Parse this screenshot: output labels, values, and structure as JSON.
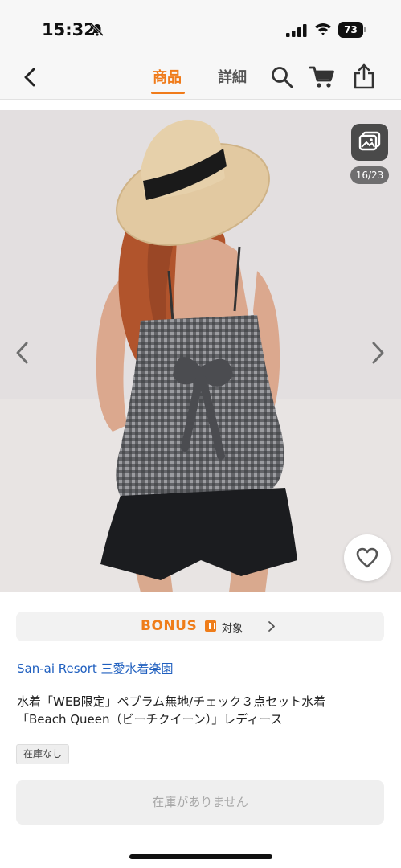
{
  "status_bar": {
    "time": "15:32",
    "battery": "73"
  },
  "nav": {
    "tab_product": "商品",
    "tab_detail": "詳細"
  },
  "gallery": {
    "counter": "16/23"
  },
  "bonus": {
    "logo": "BONUS",
    "label": "対象"
  },
  "product": {
    "brand": "San-ai Resort 三愛水着楽園",
    "title_line1": "水着「WEB限定」ペプラム無地/チェック３点セット水着",
    "title_line2": "「Beach Queen（ビーチクイーン）」レディース",
    "stock_badge": "在庫なし"
  },
  "footer": {
    "out_of_stock_button": "在庫がありません"
  },
  "colors": {
    "accent": "#f07b1a",
    "brand_link": "#1f5fbf"
  }
}
